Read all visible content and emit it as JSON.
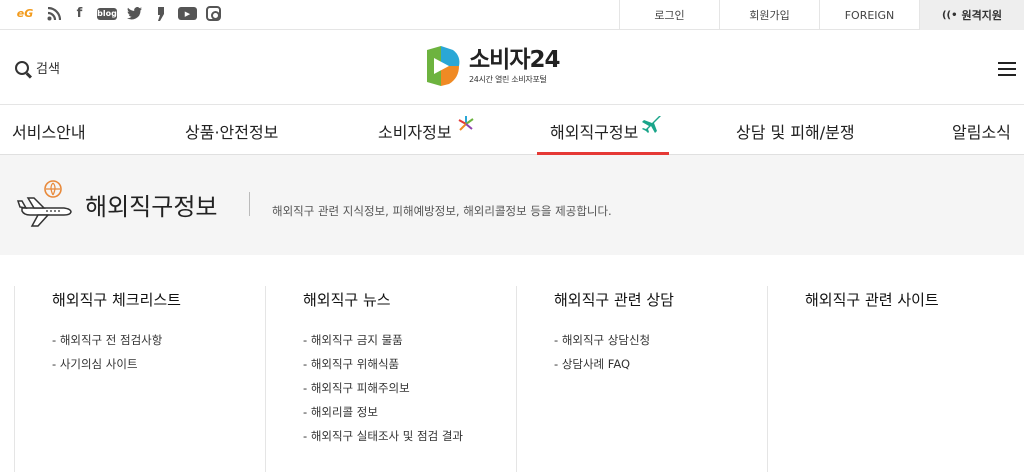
{
  "top": {
    "social": [
      {
        "icon": "eg-icon",
        "glyph": "eG"
      },
      {
        "icon": "rss-icon",
        "glyph": "⟡"
      },
      {
        "icon": "facebook-icon",
        "glyph": "f"
      },
      {
        "icon": "blog-icon",
        "glyph": "blog"
      },
      {
        "icon": "twitter-icon",
        "glyph": "✶"
      },
      {
        "icon": "post-icon",
        "glyph": "❜"
      },
      {
        "icon": "youtube-icon",
        "glyph": "▶"
      },
      {
        "icon": "instagram-icon",
        "glyph": ""
      }
    ],
    "login": "로그인",
    "join": "회원가입",
    "foreign": "FOREIGN",
    "remote": "원격지원"
  },
  "header": {
    "search_label": "검색",
    "logo_name": "소비자24",
    "logo_sub": "24시간 열린 소비자포털"
  },
  "gnb": {
    "items": [
      "서비스안내",
      "상품·안전정보",
      "소비자정보",
      "해외직구정보",
      "상담 및 피해/분쟁",
      "알림소식"
    ],
    "active_index": 3,
    "accent": "#e53935"
  },
  "banner": {
    "title": "해외직구정보",
    "description": "해외직구 관련 지식정보, 피해예방정보, 해외리콜정보 등을 제공합니다."
  },
  "columns": [
    {
      "title": "해외직구 체크리스트",
      "links": [
        "해외직구 전 점검사항",
        "사기의심 사이트"
      ]
    },
    {
      "title": "해외직구 뉴스",
      "links": [
        "해외직구 금지 물품",
        "해외직구 위해식품",
        "해외직구 피해주의보",
        "해외리콜 정보",
        "해외직구 실태조사 및 점검 결과"
      ]
    },
    {
      "title": "해외직구 관련 상담",
      "links": [
        "해외직구 상담신청",
        "상담사례 FAQ"
      ]
    },
    {
      "title": "해외직구 관련 사이트",
      "links": []
    }
  ]
}
